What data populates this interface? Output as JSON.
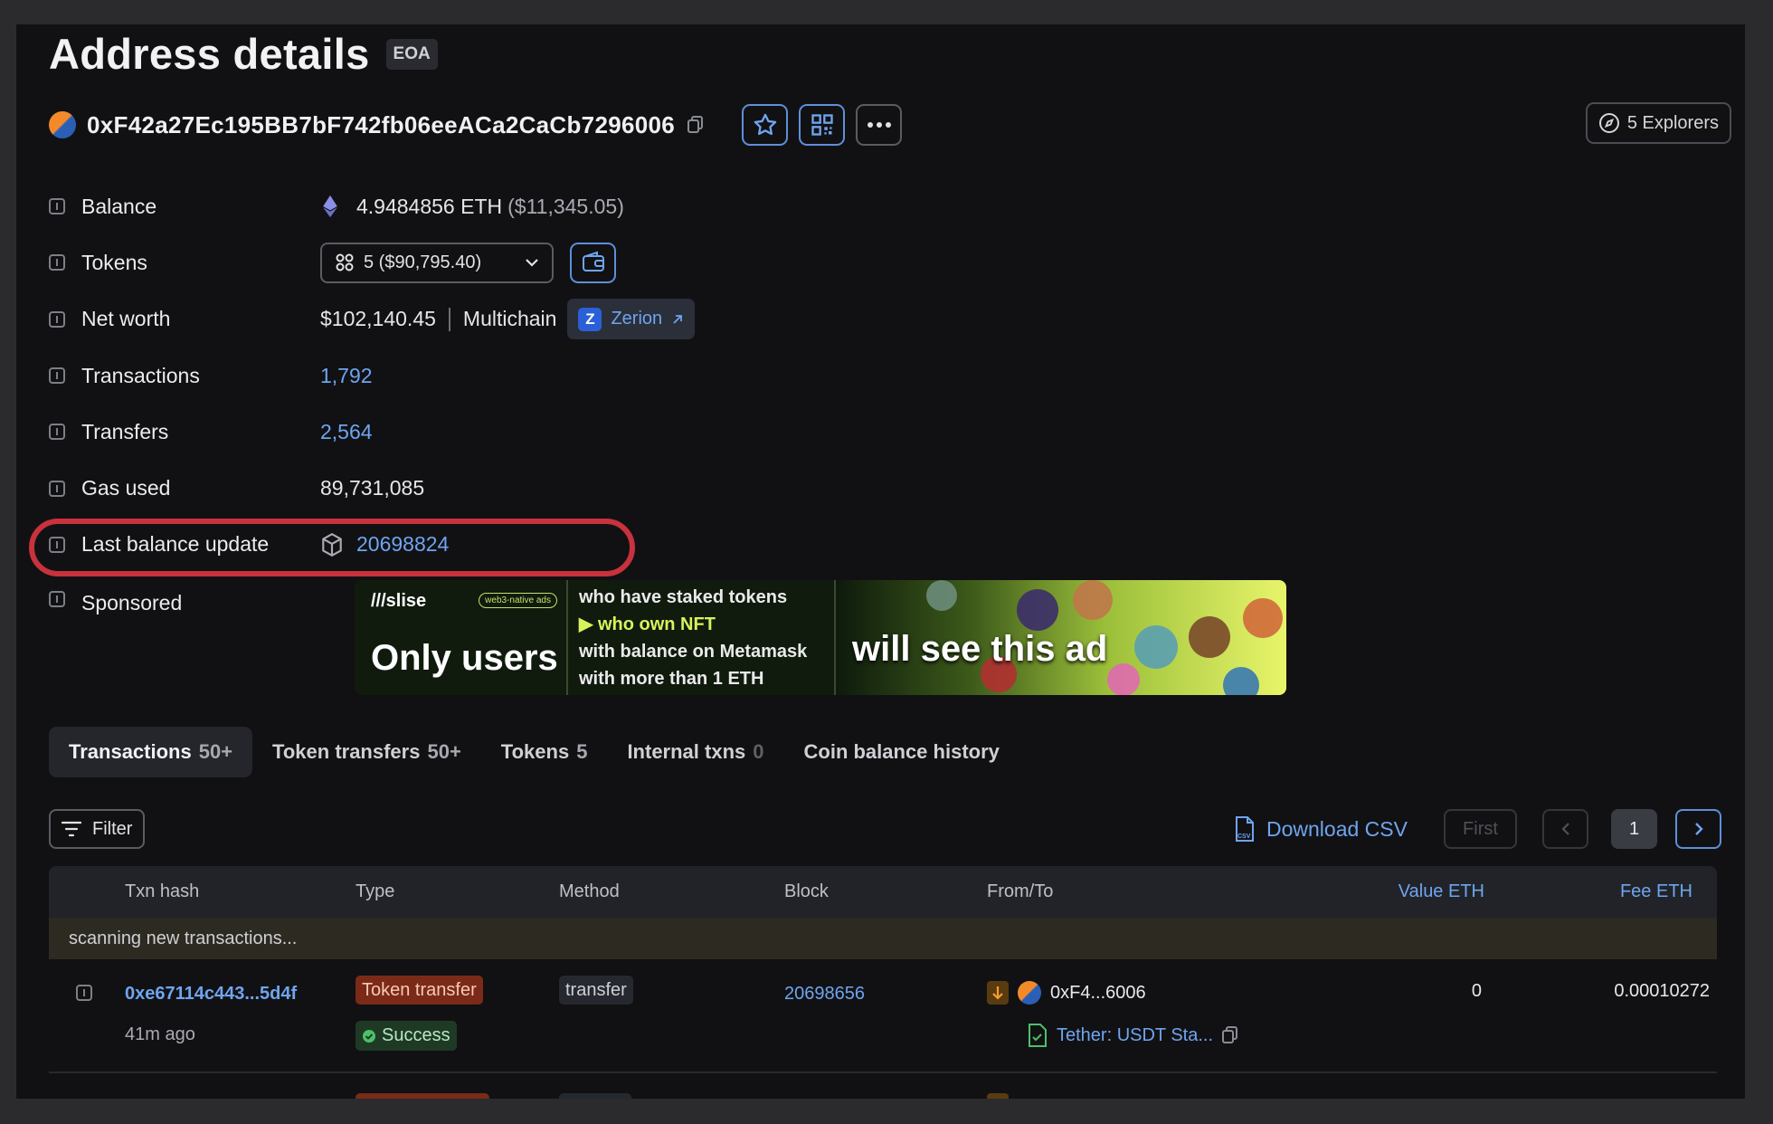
{
  "header": {
    "title": "Address details",
    "tag": "EOA"
  },
  "address": {
    "hash": "0xF42a27Ec195BB7bF742fb06eeACa2CaCb7296006",
    "explorers_label": "5 Explorers"
  },
  "details": {
    "balance": {
      "label": "Balance",
      "value": "4.9484856 ETH",
      "usd": "($11,345.05)"
    },
    "tokens": {
      "label": "Tokens",
      "value": "5 ($90,795.40)"
    },
    "net_worth": {
      "label": "Net worth",
      "value": "$102,140.45",
      "chain": "Multichain",
      "provider": "Zerion"
    },
    "transactions": {
      "label": "Transactions",
      "value": "1,792"
    },
    "transfers": {
      "label": "Transfers",
      "value": "2,564"
    },
    "gas_used": {
      "label": "Gas used",
      "value": "89,731,085"
    },
    "last_balance_update": {
      "label": "Last balance update",
      "value": "20698824"
    },
    "sponsored": {
      "label": "Sponsored"
    }
  },
  "ad": {
    "brand": "///slise",
    "badge": "web3-native ads",
    "headline": "Only users",
    "lines": [
      "who have staked tokens",
      "▶ who own NFT",
      "with balance on Metamask",
      "with more than 1 ETH"
    ],
    "tagline": "will see this ad"
  },
  "tabs": [
    {
      "label": "Transactions",
      "count": "50+",
      "active": true
    },
    {
      "label": "Token transfers",
      "count": "50+",
      "active": false
    },
    {
      "label": "Tokens",
      "count": "5",
      "active": false
    },
    {
      "label": "Internal txns",
      "count": "0",
      "active": false
    },
    {
      "label": "Coin balance history",
      "count": "",
      "active": false
    }
  ],
  "toolbar": {
    "filter_label": "Filter",
    "csv_label": "Download CSV",
    "first_label": "First",
    "page_number": "1"
  },
  "table": {
    "columns": [
      "Txn hash",
      "Type",
      "Method",
      "Block",
      "From/To",
      "Value ETH",
      "Fee ETH"
    ],
    "scanning_text": "scanning new transactions...",
    "rows": [
      {
        "hash": "0xe67114c443...5d4f",
        "age": "41m ago",
        "type": "Token transfer",
        "status": "Success",
        "method": "transfer",
        "block": "20698656",
        "from": "0xF4...6006",
        "to": "Tether: USDT Sta...",
        "value": "0",
        "fee": "0.00010272"
      }
    ]
  },
  "colors": {
    "accent": "#6fa5ee",
    "highlight": "#c8323c",
    "background": "#111114"
  }
}
